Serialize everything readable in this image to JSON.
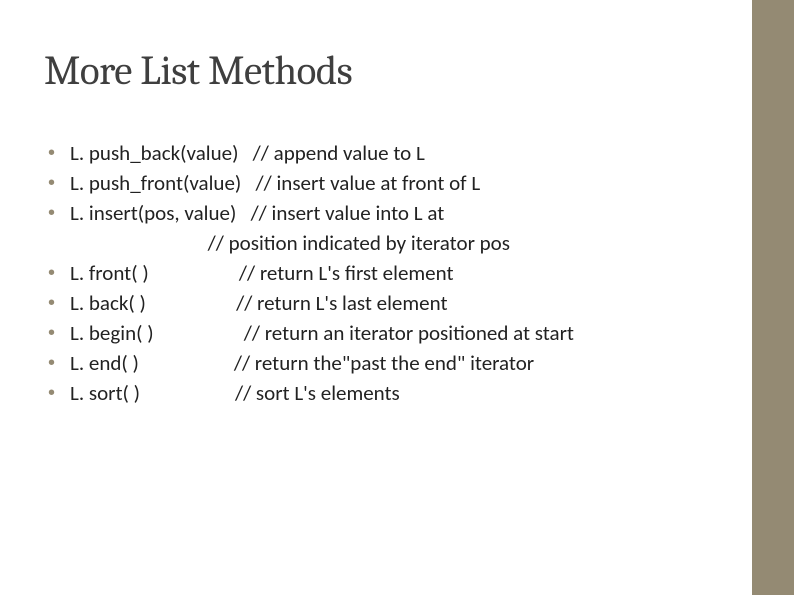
{
  "title": "More List Methods",
  "rows": [
    {
      "bullet": true,
      "text": "L. push_back(value)   // append value to L"
    },
    {
      "bullet": true,
      "text": "L. push_front(value)   // insert value at front of L"
    },
    {
      "bullet": true,
      "text": "L. insert(pos, value)   // insert value into L at"
    },
    {
      "bullet": false,
      "text": "                             // position indicated by iterator pos"
    },
    {
      "bullet": true,
      "text": "L. front( )                   // return L's first element"
    },
    {
      "bullet": true,
      "text": "L. back( )                   // return L's last element"
    },
    {
      "bullet": true,
      "text": "L. begin( )                   // return an iterator positioned at start"
    },
    {
      "bullet": true,
      "text": "L. end( )                    // return the\"past the end\" iterator"
    },
    {
      "bullet": true,
      "text": "L. sort( )                    // sort L's elements"
    }
  ]
}
